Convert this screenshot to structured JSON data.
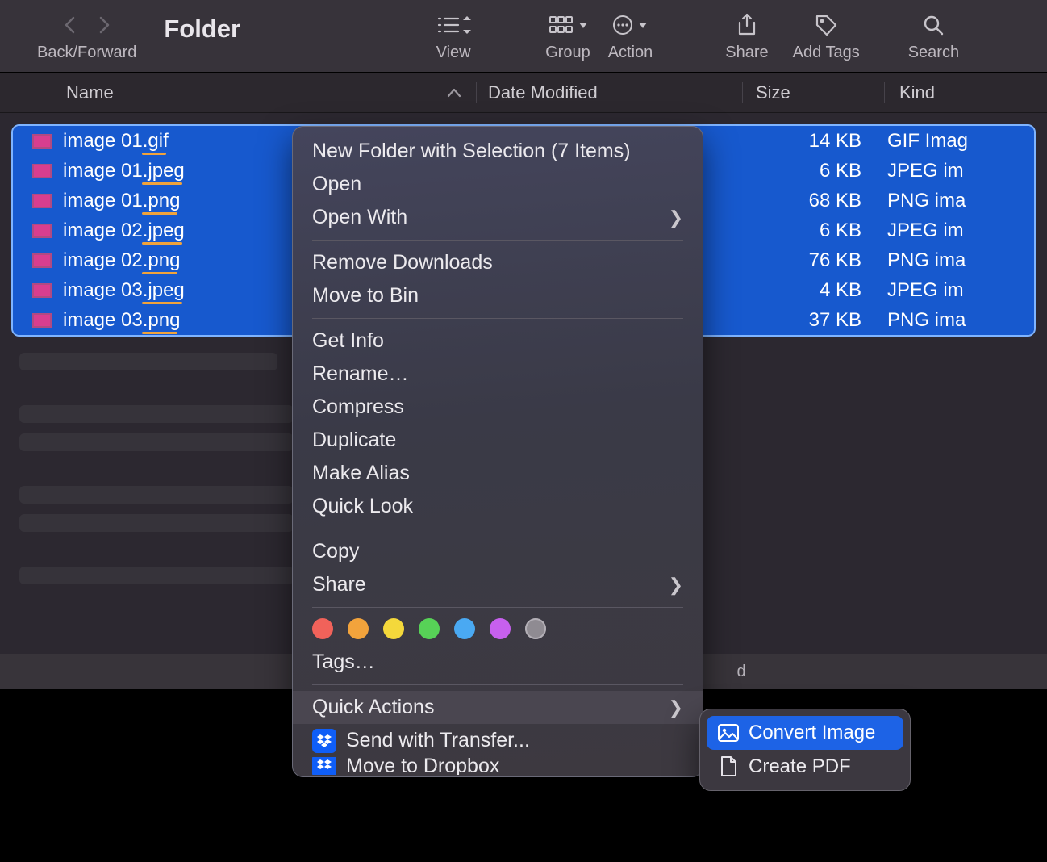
{
  "toolbar": {
    "back_forward_label": "Back/Forward",
    "folder_title": "Folder",
    "view_label": "View",
    "group_label": "Group",
    "action_label": "Action",
    "share_label": "Share",
    "add_tags_label": "Add Tags",
    "search_label": "Search"
  },
  "columns": {
    "name": "Name",
    "date_modified": "Date Modified",
    "size": "Size",
    "kind": "Kind"
  },
  "files": [
    {
      "name": "image 01.gif",
      "size": "14 KB",
      "kind": "GIF Imag"
    },
    {
      "name": "image 01.jpeg",
      "size": "6 KB",
      "kind": "JPEG im"
    },
    {
      "name": "image 01.png",
      "size": "68 KB",
      "kind": "PNG ima"
    },
    {
      "name": "image 02.jpeg",
      "size": "6 KB",
      "kind": "JPEG im"
    },
    {
      "name": "image 02.png",
      "size": "76 KB",
      "kind": "PNG ima"
    },
    {
      "name": "image 03.jpeg",
      "size": "4 KB",
      "kind": "JPEG im"
    },
    {
      "name": "image 03.png",
      "size": "37 KB",
      "kind": "PNG ima"
    }
  ],
  "statusbar": {
    "text": "d"
  },
  "context_menu": {
    "new_folder": "New Folder with Selection (7 Items)",
    "open": "Open",
    "open_with": "Open With",
    "remove_downloads": "Remove Downloads",
    "move_to_bin": "Move to Bin",
    "get_info": "Get Info",
    "rename": "Rename…",
    "compress": "Compress",
    "duplicate": "Duplicate",
    "make_alias": "Make Alias",
    "quick_look": "Quick Look",
    "copy": "Copy",
    "share": "Share",
    "tags": "Tags…",
    "quick_actions": "Quick Actions",
    "send_with_transfer": "Send with Transfer...",
    "move_to_dropbox": "Move to Dropbox"
  },
  "tag_colors": [
    "#f1625a",
    "#f2a33c",
    "#f4d83b",
    "#57d257",
    "#4aa9f2",
    "#c760ee",
    "#8f8b92"
  ],
  "submenu": {
    "convert_image": "Convert Image",
    "create_pdf": "Create PDF"
  }
}
